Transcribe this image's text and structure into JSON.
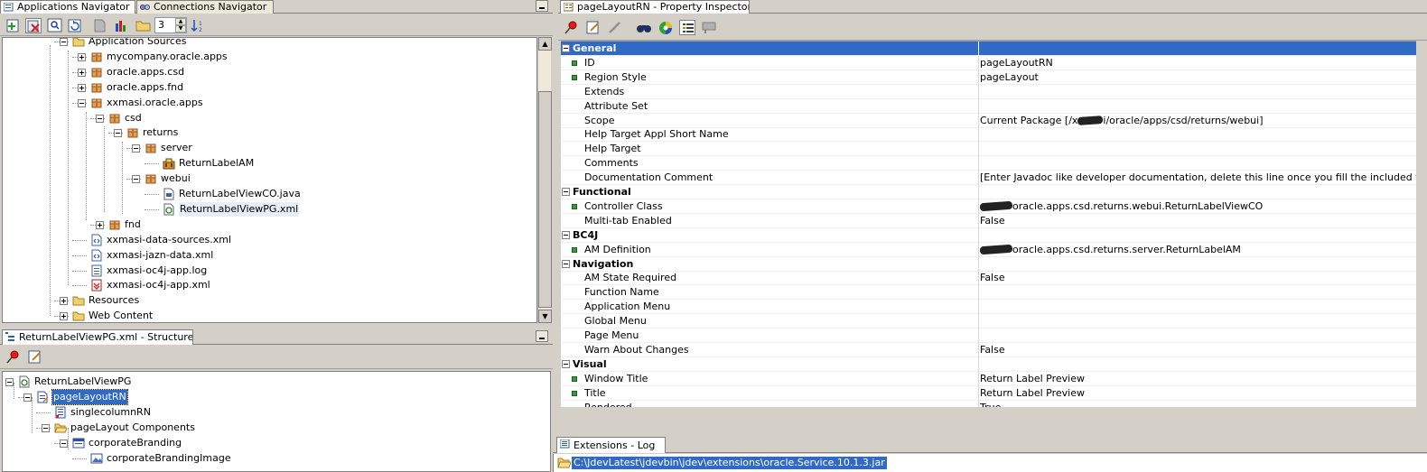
{
  "tabs": {
    "applications_navigator": "Applications Navigator",
    "connections_navigator": "Connections Navigator",
    "property_inspector": "pageLayoutRN - Property Inspector",
    "structure": "ReturnLabelViewPG.xml - Structure",
    "extensions_log": "Extensions - Log"
  },
  "navigator_toolbar": {
    "level_value": "3"
  },
  "app_tree": [
    {
      "label": "Application Sources",
      "indent": 1,
      "icon": "folder-icon",
      "expander": "minus"
    },
    {
      "label": "mycompany.oracle.apps",
      "indent": 2,
      "icon": "package-icon",
      "expander": "plus"
    },
    {
      "label": "oracle.apps.csd",
      "indent": 2,
      "icon": "package-icon",
      "expander": "plus"
    },
    {
      "label": "oracle.apps.fnd",
      "indent": 2,
      "icon": "package-icon",
      "expander": "plus"
    },
    {
      "label": "xxmasi.oracle.apps",
      "indent": 2,
      "icon": "package-icon",
      "expander": "minus"
    },
    {
      "label": "csd",
      "indent": 3,
      "icon": "package-icon",
      "expander": "minus"
    },
    {
      "label": "returns",
      "indent": 4,
      "icon": "package-icon",
      "expander": "minus"
    },
    {
      "label": "server",
      "indent": 5,
      "icon": "package-icon",
      "expander": "minus"
    },
    {
      "label": "ReturnLabelAM",
      "indent": 6,
      "icon": "app-module-icon",
      "expander": "none"
    },
    {
      "label": "webui",
      "indent": 5,
      "icon": "package-icon",
      "expander": "minus"
    },
    {
      "label": "ReturnLabelViewCO.java",
      "indent": 6,
      "icon": "java-file-icon",
      "expander": "none"
    },
    {
      "label": "ReturnLabelViewPG.xml",
      "indent": 6,
      "icon": "page-xml-icon",
      "expander": "none",
      "selected": true
    },
    {
      "label": "fnd",
      "indent": 3,
      "icon": "package-icon",
      "expander": "plus"
    },
    {
      "label": "xxmasi-data-sources.xml",
      "indent": 2,
      "icon": "xml-file-icon",
      "expander": "none"
    },
    {
      "label": "xxmasi-jazn-data.xml",
      "indent": 2,
      "icon": "xml-file-icon",
      "expander": "none"
    },
    {
      "label": "xxmasi-oc4j-app.log",
      "indent": 2,
      "icon": "log-file-icon",
      "expander": "none"
    },
    {
      "label": "xxmasi-oc4j-app.xml",
      "indent": 2,
      "icon": "oc4j-xml-icon",
      "expander": "none"
    },
    {
      "label": "Resources",
      "indent": 1,
      "icon": "folder-icon",
      "expander": "plus"
    },
    {
      "label": "Web Content",
      "indent": 1,
      "icon": "folder-icon",
      "expander": "plus"
    }
  ],
  "structure_tree": [
    {
      "label": "ReturnLabelViewPG",
      "indent": 0,
      "icon": "page-xml-icon",
      "expander": "minus"
    },
    {
      "label": "pageLayoutRN",
      "indent": 1,
      "icon": "region-icon",
      "expander": "minus",
      "selected": true
    },
    {
      "label": "singlecolumnRN",
      "indent": 2,
      "icon": "column-region-icon",
      "expander": "none"
    },
    {
      "label": "pageLayout Components",
      "indent": 2,
      "icon": "open-folder-icon",
      "expander": "minus"
    },
    {
      "label": "corporateBranding",
      "indent": 3,
      "icon": "branding-icon",
      "expander": "minus"
    },
    {
      "label": "corporateBrandingImage",
      "indent": 4,
      "icon": "image-icon",
      "expander": "none"
    }
  ],
  "properties": [
    {
      "type": "category",
      "name": "General",
      "selected": true
    },
    {
      "name": "ID",
      "value": "pageLayoutRN",
      "required": true
    },
    {
      "name": "Region Style",
      "value": "pageLayout",
      "required": true
    },
    {
      "name": "Extends",
      "value": ""
    },
    {
      "name": "Attribute Set",
      "value": ""
    },
    {
      "name": "Scope",
      "value_prefix": "Current Package [/x",
      "redacted": true,
      "value": "i/oracle/apps/csd/returns/webui]"
    },
    {
      "name": "Help Target Appl Short Name",
      "value": ""
    },
    {
      "name": "Help Target",
      "value": ""
    },
    {
      "name": "Comments",
      "value": ""
    },
    {
      "name": "Documentation Comment",
      "value": "[Enter Javadoc like developer documentation, delete this line once you fill the included template.][..."
    },
    {
      "type": "category",
      "name": "Functional"
    },
    {
      "name": "Controller Class",
      "value_prefix": "",
      "redacted": true,
      "value": "oracle.apps.csd.returns.webui.ReturnLabelViewCO",
      "required": true
    },
    {
      "name": "Multi-tab Enabled",
      "value": "False"
    },
    {
      "type": "category",
      "name": "BC4J"
    },
    {
      "name": "AM Definition",
      "value_prefix": "",
      "redacted": true,
      "value": "oracle.apps.csd.returns.server.ReturnLabelAM",
      "required": true
    },
    {
      "type": "category",
      "name": "Navigation"
    },
    {
      "name": "AM State Required",
      "value": "False"
    },
    {
      "name": "Function Name",
      "value": ""
    },
    {
      "name": "Application Menu",
      "value": ""
    },
    {
      "name": "Global Menu",
      "value": ""
    },
    {
      "name": "Page Menu",
      "value": ""
    },
    {
      "name": "Warn About Changes",
      "value": "False"
    },
    {
      "type": "category",
      "name": "Visual"
    },
    {
      "name": "Window Title",
      "value": "Return Label Preview",
      "required": true
    },
    {
      "name": "Title",
      "value": "Return Label Preview",
      "required": true
    },
    {
      "name": "Rendered",
      "value": "True"
    }
  ],
  "log": {
    "line": "C:\\JdevLatest\\jdevbin\\jdev\\extensions\\oracle.Service.10.1.3.jar"
  }
}
